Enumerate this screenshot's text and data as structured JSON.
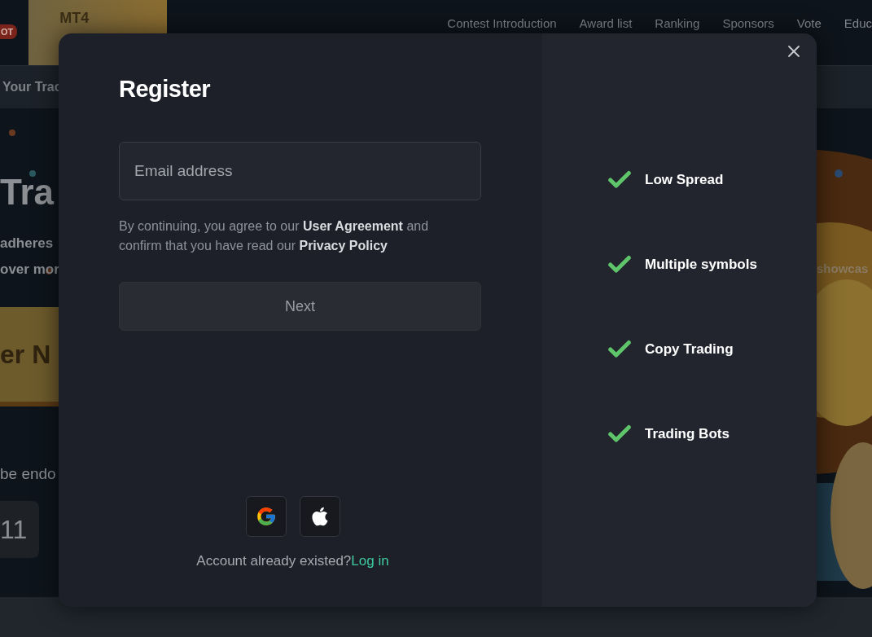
{
  "page": {
    "hot_badge": "OT",
    "logo": "MT4",
    "nav": [
      "Contest Introduction",
      "Award list",
      "Ranking",
      "Sponsors",
      "Vote",
      "Educ"
    ],
    "banner": "Your Trac",
    "hero": {
      "title": "Tra",
      "lines": [
        "adheres",
        "over mor"
      ],
      "cta": "er N",
      "notice": "be endo",
      "countdown": "11",
      "side_text": "showcas"
    }
  },
  "dialog": {
    "title": "Register",
    "email": {
      "placeholder": "Email address"
    },
    "consent": "By continuing, you agree to our **User Agreement** and confirm that you have read our **Privacy Policy**",
    "next_button": {
      "label": "Next",
      "disabled": true
    },
    "social": [
      {
        "kind": "google"
      },
      {
        "kind": "apple"
      }
    ],
    "login_prompt": "Account already existed?",
    "login_link": "Log in",
    "features": [
      "Low Spread",
      "Multiple symbols",
      "Copy Trading",
      "Trading Bots"
    ]
  }
}
